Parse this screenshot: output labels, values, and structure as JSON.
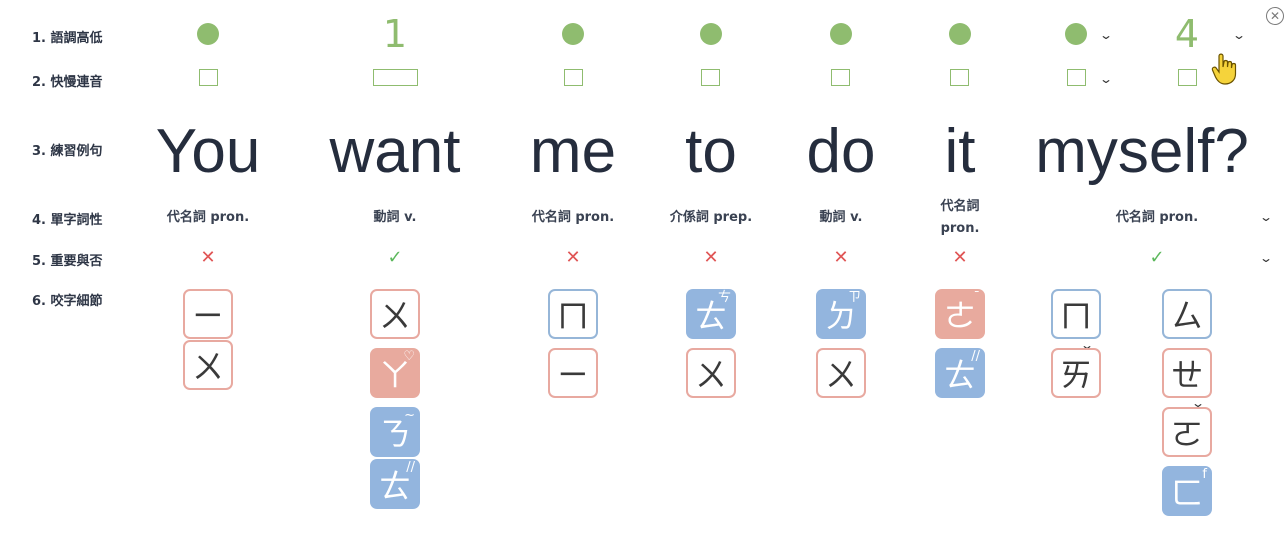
{
  "rows": {
    "tone_label": "1. 語調高低",
    "linking_label": "2. 快慢連音",
    "sentence_label": "3. 練習例句",
    "pos_label": "4. 單字詞性",
    "importance_label": "5. 重要與否",
    "bite_label": "6. 咬字細節"
  },
  "tone_numbers": {
    "want": "1",
    "self": "4"
  },
  "words": [
    "You",
    "want",
    "me",
    "to",
    "do",
    "it",
    "myself?"
  ],
  "pos": {
    "you": "代名詞 pron.",
    "want": "動詞 v.",
    "me": "代名詞 pron.",
    "to": "介係詞 prep.",
    "do": "動詞 v.",
    "it_line1": "代名詞",
    "it_line2": "pron.",
    "myself": "代名詞 pron."
  },
  "importance": {
    "cross": "✕",
    "check": "✓"
  },
  "zhuyin": {
    "you": [
      "ㄧ",
      "ㄨ"
    ],
    "want": [
      "ㄨ",
      "ㄚ",
      "ㄋ",
      "ㄊ"
    ],
    "me": [
      "ㄇ",
      "ㄧ"
    ],
    "to": [
      "ㄊ",
      "ㄨ"
    ],
    "do": [
      "ㄉ",
      "ㄨ"
    ],
    "it": [
      "ㄜ",
      "ㄊ"
    ],
    "my": [
      "ㄇ",
      "ㄞ"
    ],
    "self": [
      "ㄙ",
      "ㄝ",
      "ㄛ",
      "ㄈ"
    ]
  },
  "tone_marks": {
    "want_a": "♡",
    "want_n": "~",
    "want_t": "//",
    "to_t": "ㄘ",
    "do_d": "ㄗ",
    "it_e": "ˉ",
    "it_t": "//",
    "self_f": "f"
  },
  "icons": {
    "chevron": "chevron-down-icon",
    "close": "close-icon",
    "cursor": "hand-pointer-icon"
  },
  "colors": {
    "green": "#8fbc6f",
    "pink": "#e8aa9e",
    "blue": "#93b5de",
    "cross": "#e05555",
    "check": "#5cb85c"
  }
}
